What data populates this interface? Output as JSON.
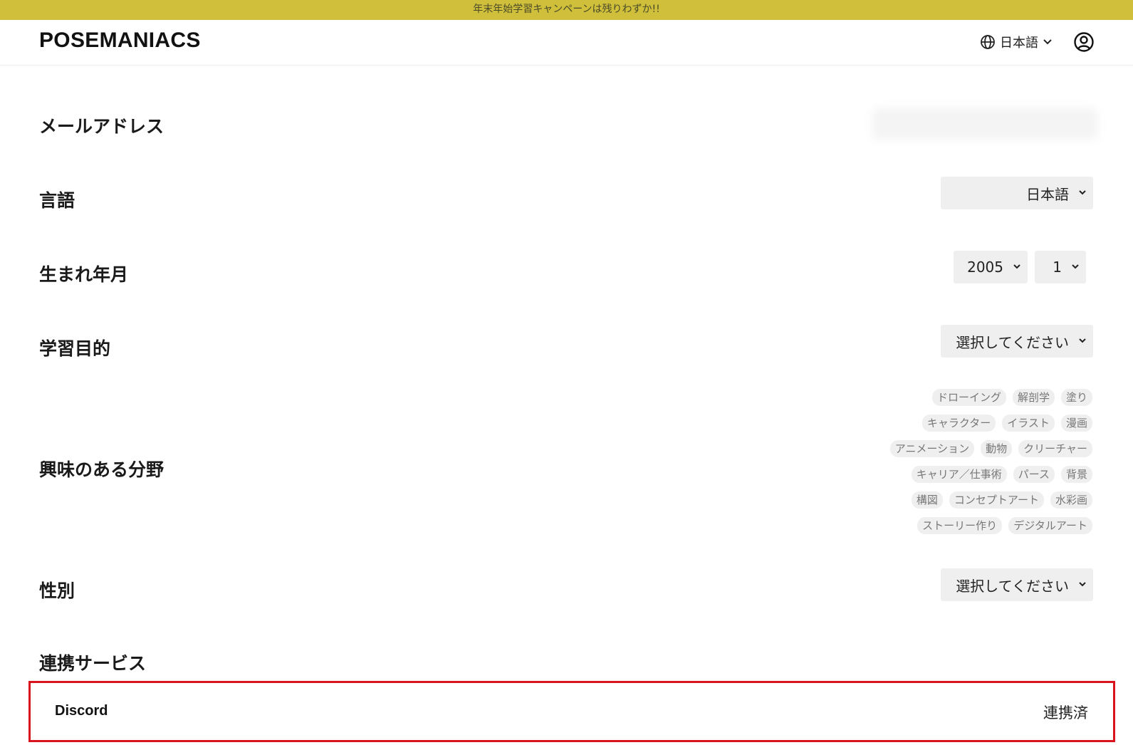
{
  "banner": {
    "text": "年末年始学習キャンペーンは残りわずか!!"
  },
  "header": {
    "logo": "POSEMANIACS",
    "language": "日本語",
    "language_icon": "globe-icon",
    "account_icon": "user-circle-icon"
  },
  "fields": {
    "email": {
      "label": "メールアドレス"
    },
    "language": {
      "label": "言語",
      "value": "日本語"
    },
    "birth": {
      "label": "生まれ年月",
      "year": "2005",
      "month": "1"
    },
    "purpose": {
      "label": "学習目的",
      "value": "選択してください"
    },
    "interests": {
      "label": "興味のある分野",
      "tags": [
        [
          "ドローイング",
          "解剖学",
          "塗り"
        ],
        [
          "キャラクター",
          "イラスト",
          "漫画"
        ],
        [
          "アニメーション",
          "動物",
          "クリーチャー"
        ],
        [
          "キャリア／仕事術",
          "パース",
          "背景"
        ],
        [
          "構図",
          "コンセプトアート",
          "水彩画"
        ],
        [
          "ストーリー作り",
          "デジタルアート"
        ]
      ]
    },
    "gender": {
      "label": "性別",
      "value": "選択してください"
    },
    "linked_services": {
      "label": "連携サービス",
      "items": [
        {
          "name": "Discord",
          "status": "連携済"
        }
      ]
    }
  },
  "colors": {
    "banner": "#cfbf3a",
    "highlight_border": "#d9141f",
    "select_bg": "#efefef"
  }
}
